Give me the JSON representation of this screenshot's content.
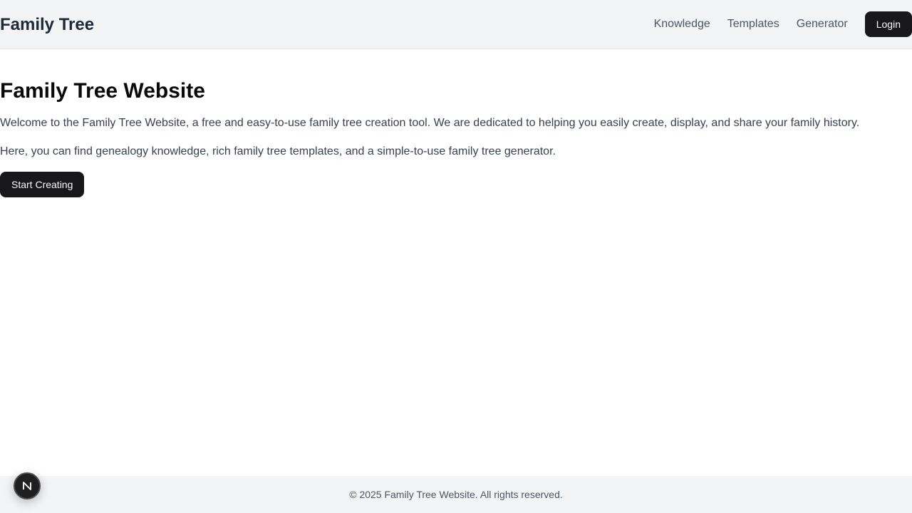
{
  "header": {
    "brand": "Family Tree",
    "nav": [
      "Knowledge",
      "Templates",
      "Generator"
    ],
    "login_label": "Login"
  },
  "hero": {
    "title": "Family Tree Website",
    "paragraph1": "Welcome to the Family Tree Website, a free and easy-to-use family tree creation tool. We are dedicated to helping you easily create, display, and share your family history.",
    "paragraph2": "Here, you can find genealogy knowledge, rich family tree templates, and a simple-to-use family tree generator.",
    "cta_label": "Start Creating"
  },
  "footer": {
    "copyright": "© 2025 Family Tree Website. All rights reserved."
  },
  "dev_badge": {
    "icon": "nextjs-logo-icon"
  },
  "colors": {
    "header_bg": "#f3f4f6",
    "button_bg": "#18181b",
    "button_text": "#fafafa",
    "nav_text": "#4b5563",
    "body_text": "#374151"
  }
}
